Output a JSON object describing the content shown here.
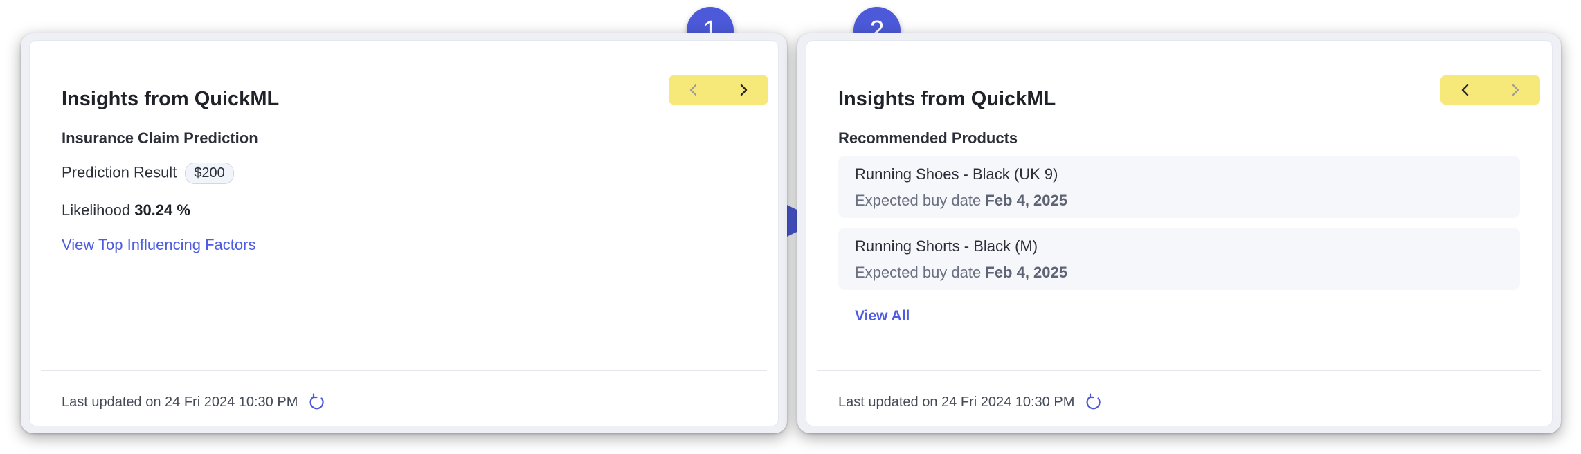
{
  "steps": {
    "one": "1",
    "two": "2"
  },
  "card1": {
    "title": "Insights from QuickML",
    "subtitle": "Insurance Claim Prediction",
    "prediction_label": "Prediction Result",
    "prediction_value": "$200",
    "likelihood_label": "Likelihood",
    "likelihood_value": "30.24 %",
    "link": "View Top Influencing Factors",
    "footer": "Last updated on 24 Fri 2024 10:30 PM",
    "nav_prev_enabled": false,
    "nav_next_enabled": true
  },
  "card2": {
    "title": "Insights from QuickML",
    "subtitle": "Recommended Products",
    "products": [
      {
        "name": "Running Shoes - Black (UK 9)",
        "buy_label": "Expected buy date",
        "buy_date": "Feb 4, 2025"
      },
      {
        "name": "Running Shorts - Black (M)",
        "buy_label": "Expected buy date",
        "buy_date": "Feb 4, 2025"
      }
    ],
    "link": "View All",
    "footer": "Last updated on 24 Fri 2024 10:30 PM",
    "nav_prev_enabled": true,
    "nav_next_enabled": false
  },
  "icons": {
    "prev": "chevron-left-icon",
    "next": "chevron-right-icon",
    "refresh": "refresh-icon",
    "flow": "play-arrow-icon"
  },
  "colors": {
    "accent": "#4c5ad9",
    "nav_bg": "#f6e879",
    "link": "#4d5ce0",
    "chevron_active": "#2a2a2a",
    "chevron_disabled": "#9b9b9b"
  }
}
